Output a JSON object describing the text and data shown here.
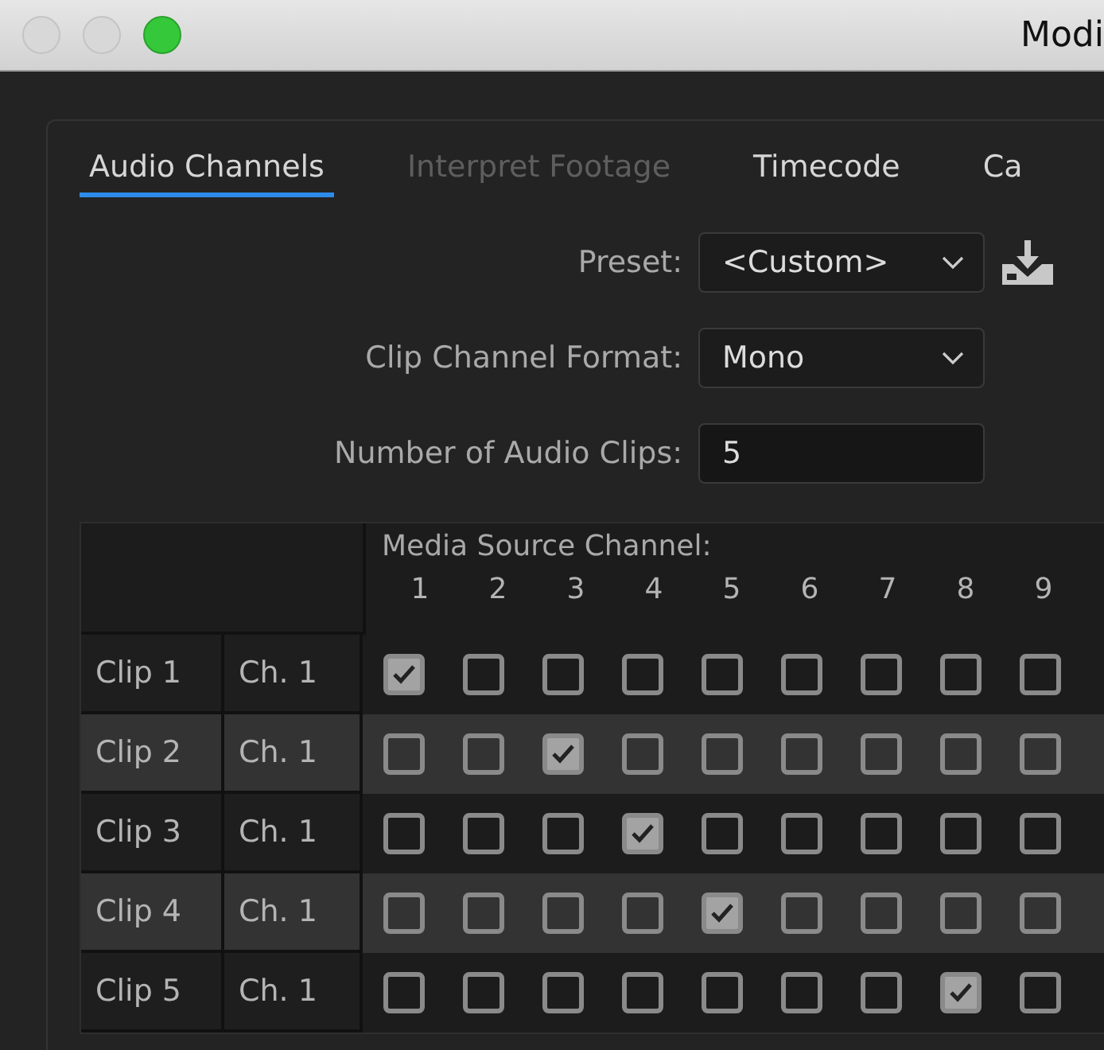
{
  "window": {
    "title": "Modi"
  },
  "tabs": [
    {
      "label": "Audio Channels",
      "selected": true,
      "disabled": false
    },
    {
      "label": "Interpret Footage",
      "selected": false,
      "disabled": true
    },
    {
      "label": "Timecode",
      "selected": false,
      "disabled": false
    },
    {
      "label": "Ca",
      "selected": false,
      "disabled": false
    }
  ],
  "form": [
    {
      "kind": "select",
      "label": "Preset:",
      "value": "<Custom>"
    },
    {
      "kind": "select",
      "label": "Clip Channel Format:",
      "value": "Mono"
    },
    {
      "kind": "input",
      "label": "Number of Audio Clips:",
      "value": "5"
    }
  ],
  "table": {
    "header": "Media Source Channel:",
    "channels": [
      "1",
      "2",
      "3",
      "4",
      "5",
      "6",
      "7",
      "8",
      "9"
    ],
    "rows": [
      {
        "clip": "Clip 1",
        "channel": "Ch. 1",
        "checks": [
          true,
          false,
          false,
          false,
          false,
          false,
          false,
          false,
          false
        ]
      },
      {
        "clip": "Clip 2",
        "channel": "Ch. 1",
        "checks": [
          false,
          false,
          true,
          false,
          false,
          false,
          false,
          false,
          false
        ]
      },
      {
        "clip": "Clip 3",
        "channel": "Ch. 1",
        "checks": [
          false,
          false,
          false,
          true,
          false,
          false,
          false,
          false,
          false
        ]
      },
      {
        "clip": "Clip 4",
        "channel": "Ch. 1",
        "checks": [
          false,
          false,
          false,
          false,
          true,
          false,
          false,
          false,
          false
        ]
      },
      {
        "clip": "Clip 5",
        "channel": "Ch. 1",
        "checks": [
          false,
          false,
          false,
          false,
          false,
          false,
          false,
          true,
          false
        ]
      }
    ]
  }
}
